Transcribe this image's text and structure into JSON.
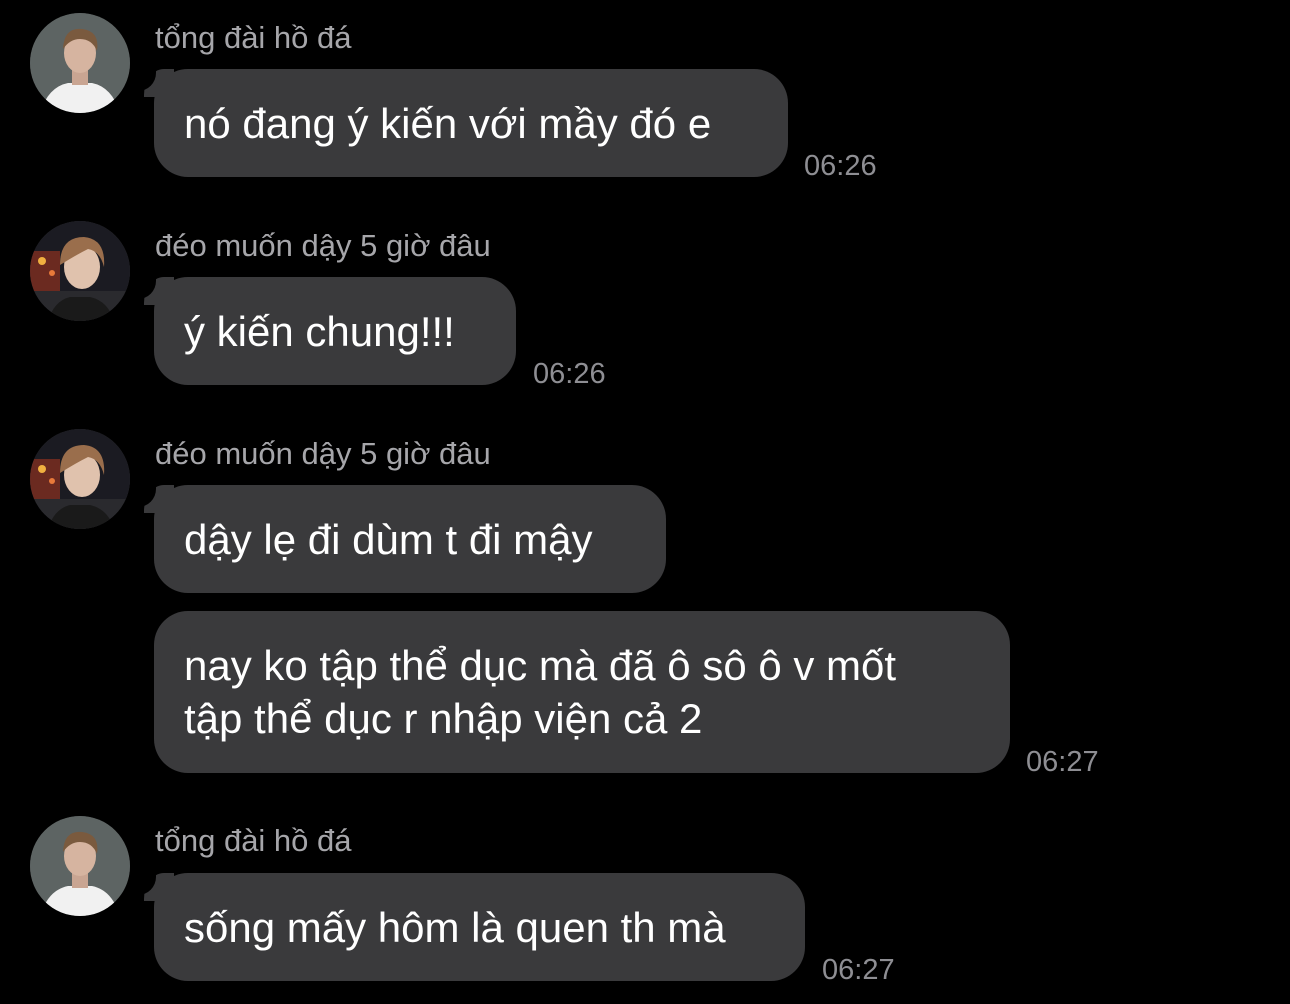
{
  "messages": [
    {
      "sender": "tổng đài hồ đá",
      "avatar": "avatar-male-white-shirt",
      "text": "nó đang ý kiến với mầy đó e",
      "time": "06:26"
    },
    {
      "sender": "đéo muốn dậy 5 giờ đâu",
      "avatar": "avatar-male-night-lights",
      "text": "ý kiến chung!!!",
      "time": "06:26"
    },
    {
      "sender": "đéo muốn dậy 5 giờ đâu",
      "avatar": "avatar-male-night-lights",
      "text": "dậy lẹ đi dùm t đi mậy",
      "time": ""
    },
    {
      "sender": "",
      "avatar": "",
      "text_lines": [
        "nay ko tập thể dục mà đã ô sô ô v mốt",
        "tập thể dục r nhập viện cả 2"
      ],
      "time": "06:27"
    },
    {
      "sender": "tổng đài hồ đá",
      "avatar": "avatar-male-white-shirt",
      "text": "sống mấy hôm là quen th mà",
      "time": "06:27"
    }
  ],
  "colors": {
    "background": "#000000",
    "bubble": "#3a3a3c",
    "sender": "#a6a6aa",
    "time": "#8e8e93"
  }
}
